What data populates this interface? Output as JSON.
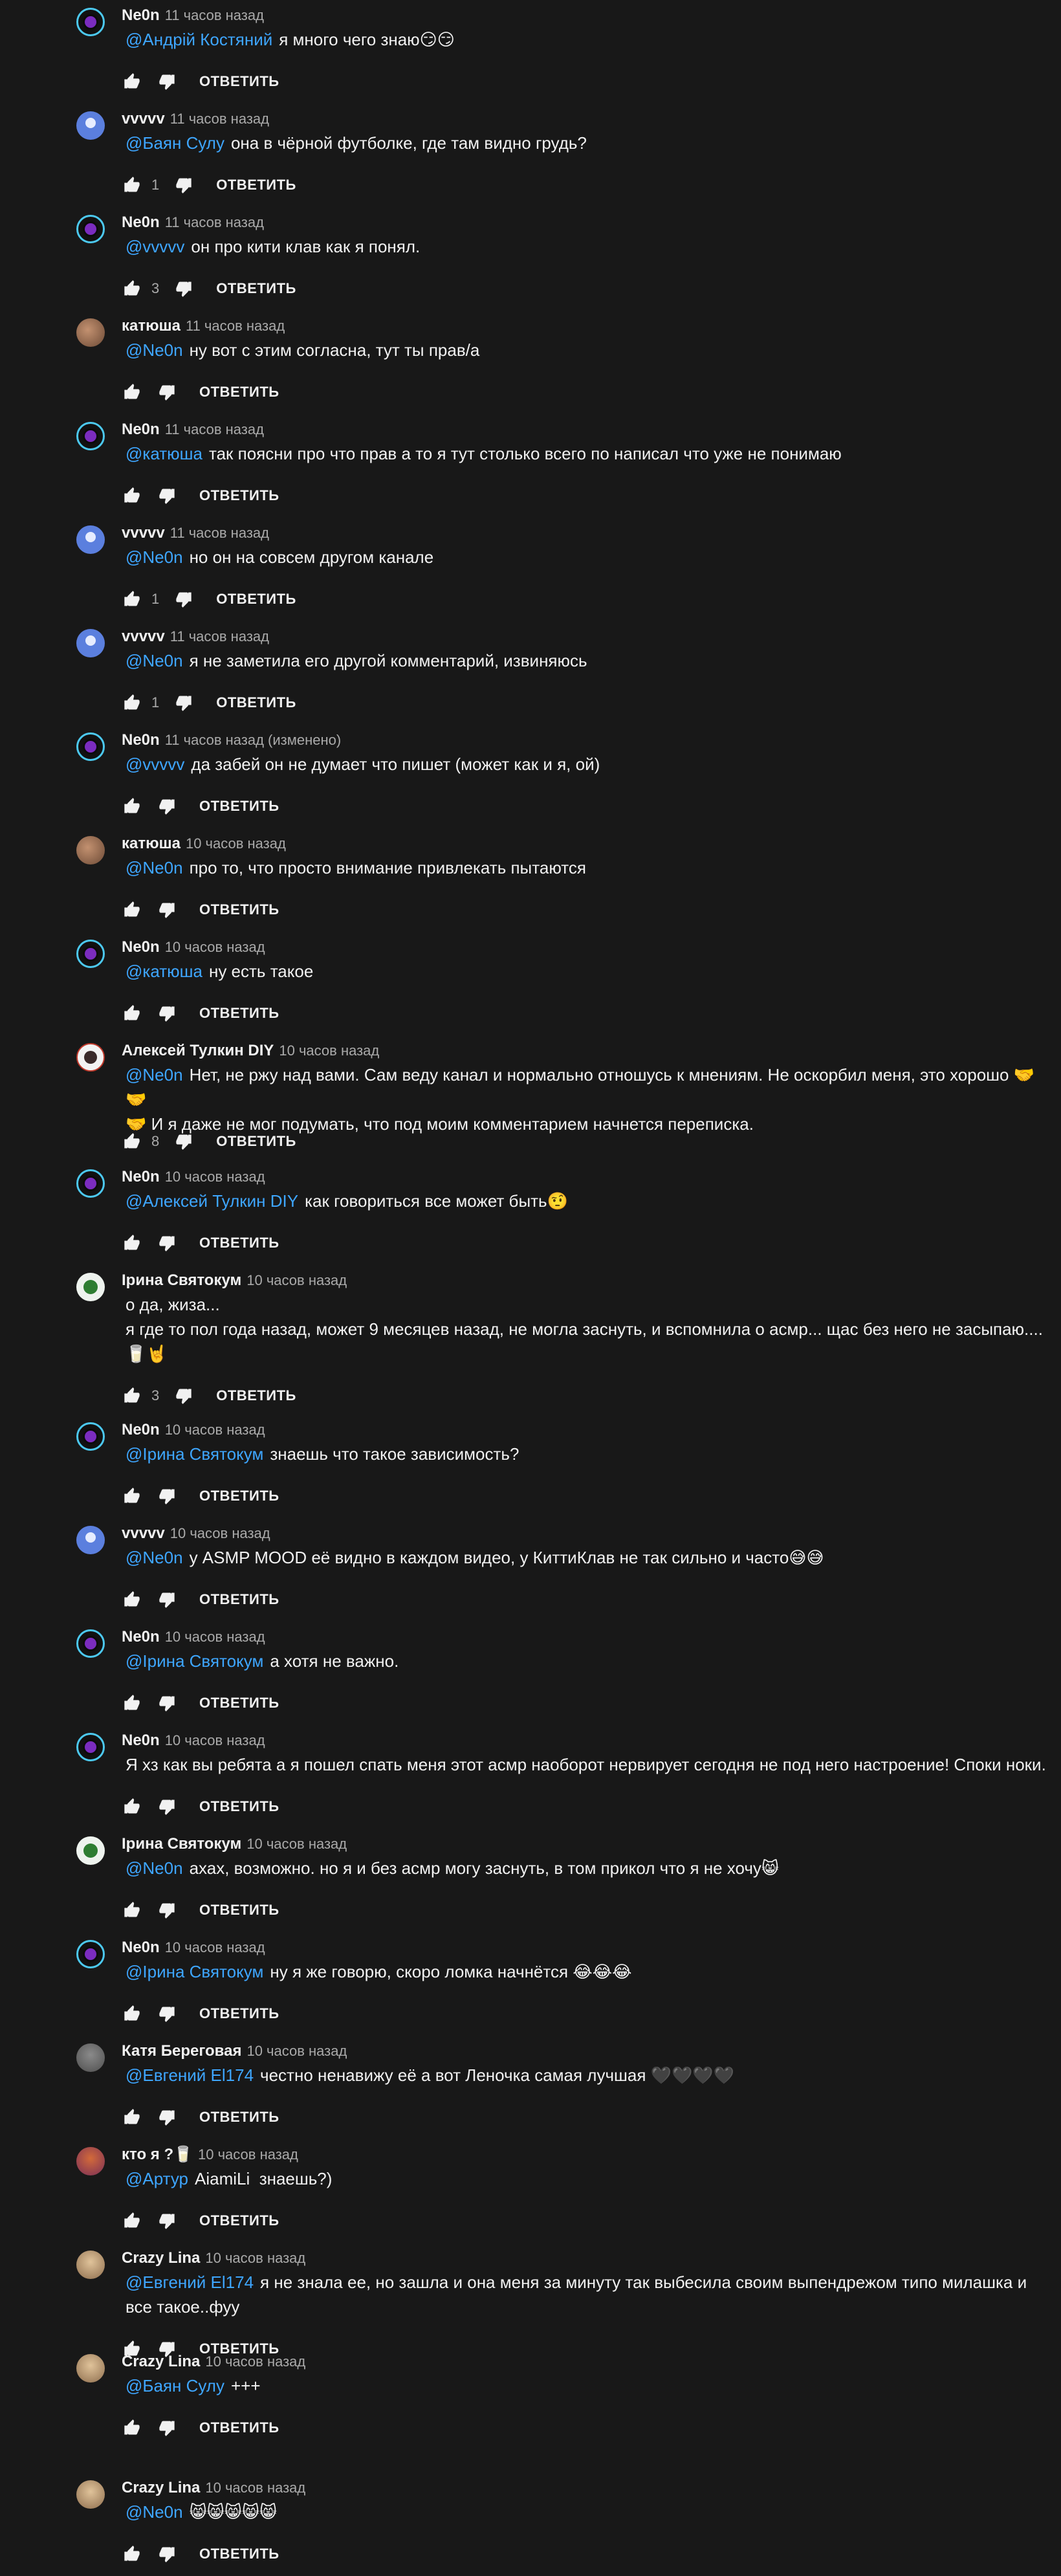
{
  "labels": {
    "reply": "ОТВЕТИТЬ"
  },
  "icons": {
    "like": "thumbs-up-icon",
    "dislike": "thumbs-down-icon"
  },
  "comments": [
    {
      "author": "Ne0n",
      "avatar": "neon",
      "time": "11 часов назад",
      "mention": "@Андрій Костяний",
      "text": "я много чего знаю😏😏",
      "likes": ""
    },
    {
      "author": "vvvvv",
      "avatar": "vvvvv",
      "time": "11 часов назад",
      "mention": "@Баян Сулу",
      "text": "она в чёрной футболке, где там видно грудь?",
      "likes": "1"
    },
    {
      "author": "Ne0n",
      "avatar": "neon",
      "time": "11 часов назад",
      "mention": "@vvvvv",
      "text": "он про кити клав как я понял.",
      "likes": "3"
    },
    {
      "author": "катюша",
      "avatar": "katyusha",
      "time": "11 часов назад",
      "mention": "@Ne0n",
      "text": "ну вот с этим согласна, тут ты прав/а",
      "likes": ""
    },
    {
      "author": "Ne0n",
      "avatar": "neon",
      "time": "11 часов назад",
      "mention": "@катюша",
      "text": "так поясни про что прав а то я тут столько всего по написал что уже не понимаю",
      "likes": ""
    },
    {
      "author": "vvvvv",
      "avatar": "vvvvv",
      "time": "11 часов назад",
      "mention": "@Ne0n",
      "text": "но он на совсем другом канале",
      "likes": "1"
    },
    {
      "author": "vvvvv",
      "avatar": "vvvvv",
      "time": "11 часов назад",
      "mention": "@Ne0n",
      "text": "я не заметила его другой комментарий, извиняюсь",
      "likes": "1"
    },
    {
      "author": "Ne0n",
      "avatar": "neon",
      "time": "11 часов назад (изменено)",
      "mention": "@vvvvv",
      "text": "да забей он не думает что пишет (может как и я, ой)",
      "likes": ""
    },
    {
      "author": "катюша",
      "avatar": "katyusha",
      "time": "10 часов назад",
      "mention": "@Ne0n",
      "text": "про то, что просто внимание привлекать пытаются",
      "likes": ""
    },
    {
      "author": "Ne0n",
      "avatar": "neon",
      "time": "10 часов назад",
      "mention": "@катюша",
      "text": "ну есть такое",
      "likes": ""
    },
    {
      "author": "Алексей Тулкин DIY",
      "avatar": "aleksey",
      "time": "10 часов назад",
      "mention": "@Ne0n",
      "text": "Нет, не ржу над вами. Сам веду канал и нормально отношусь к мнениям. Не оскорбил меня, это хорошо 🤝🤝\n🤝 И я даже не мог подумать, что под моим комментарием начнется переписка.",
      "likes": "8"
    },
    {
      "author": "Ne0n",
      "avatar": "neon",
      "time": "10 часов назад",
      "mention": "@Алексей Тулкин DIY",
      "text": "как говориться все может быть🤨",
      "likes": ""
    },
    {
      "author": "Ірина Святокум",
      "avatar": "irina",
      "time": "10 часов назад",
      "mention": "",
      "text": "о да, жиза...\nя где то пол года назад, может 9 месяцев назад, не могла заснуть, и вспомнила о асмр... щас без него не засыпаю....\n🥛🤘",
      "likes": "3"
    },
    {
      "author": "Ne0n",
      "avatar": "neon",
      "time": "10 часов назад",
      "mention": "@Ірина Святокум",
      "text": "знаешь что такое зависимость?",
      "likes": ""
    },
    {
      "author": "vvvvv",
      "avatar": "vvvvv",
      "time": "10 часов назад",
      "mention": "@Ne0n",
      "text": "у ASMP MOOD её видно в каждом видео, у КиттиКлав не так сильно и часто😅😅",
      "likes": ""
    },
    {
      "author": "Ne0n",
      "avatar": "neon",
      "time": "10 часов назад",
      "mention": "@Ірина Святокум",
      "text": "а хотя не важно.",
      "likes": ""
    },
    {
      "author": "Ne0n",
      "avatar": "neon",
      "time": "10 часов назад",
      "mention": "",
      "text": "Я хз как вы ребята а я пошел спать меня этот асмр наоборот нервирует сегодня не под него настроение! Споки ноки.",
      "likes": ""
    },
    {
      "author": "Ірина Святокум",
      "avatar": "irina",
      "time": "10 часов назад",
      "mention": "@Ne0n",
      "text": "ахах, возможно. но я и без асмр могу заснуть, в том прикол что я не хочу😸",
      "likes": ""
    },
    {
      "author": "Ne0n",
      "avatar": "neon",
      "time": "10 часов назад",
      "mention": "@Ірина Святокум",
      "text": "ну я же говорю, скоро ломка начнётся 😂😂😂",
      "likes": ""
    },
    {
      "author": "Катя Береговая",
      "avatar": "katya",
      "time": "10 часов назад",
      "mention": "@Евгений El174",
      "text": "честно ненавижу её а вот Леночка самая лучшая 🖤🖤🖤🖤",
      "likes": ""
    },
    {
      "author": "кто я ?🥛",
      "avatar": "ktoya",
      "time": "10 часов назад",
      "mention": "@Артур",
      "text": "AiamiLi  знаешь?)",
      "likes": ""
    },
    {
      "author": "Crazy Lina",
      "avatar": "crazy",
      "time": "10 часов назад",
      "mention": "@Евгений El174",
      "text": "я не знала ее, но зашла и она меня за минуту так выбесила своим выпендрежом типо милашка и\nвсе такое..фуу",
      "likes": ""
    },
    {
      "author": "Crazy Lina",
      "avatar": "crazy",
      "time": "10 часов назад",
      "mention": "@Баян Сулу",
      "text": "+++",
      "likes": ""
    },
    {
      "author": "Crazy Lina",
      "avatar": "crazy",
      "time": "10 часов назад",
      "mention": "@Ne0n",
      "text": "😸😸😸😸😸",
      "likes": ""
    }
  ]
}
